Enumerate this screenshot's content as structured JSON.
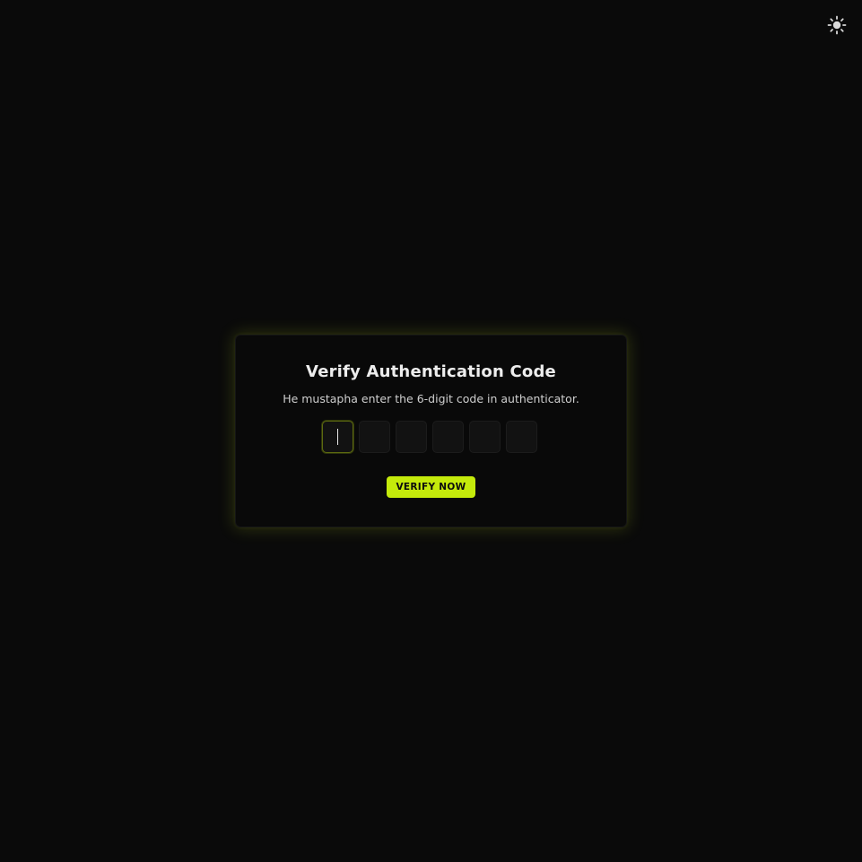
{
  "header": {
    "theme_toggle_icon": "sun-icon"
  },
  "card": {
    "title": "Verify Authentication Code",
    "subtitle": "He mustapha enter the 6-digit code in authenticator.",
    "code_inputs": [
      {
        "value": ""
      },
      {
        "value": ""
      },
      {
        "value": ""
      },
      {
        "value": ""
      },
      {
        "value": ""
      },
      {
        "value": ""
      }
    ],
    "active_input_index": 0,
    "verify_button_label": "VERIFY NOW"
  },
  "colors": {
    "background": "#0a0a0a",
    "card_background": "#090909",
    "accent": "#c4ea0b",
    "active_border": "#5d6a10",
    "text_primary": "#ededed",
    "text_secondary": "#cfcfcf"
  }
}
